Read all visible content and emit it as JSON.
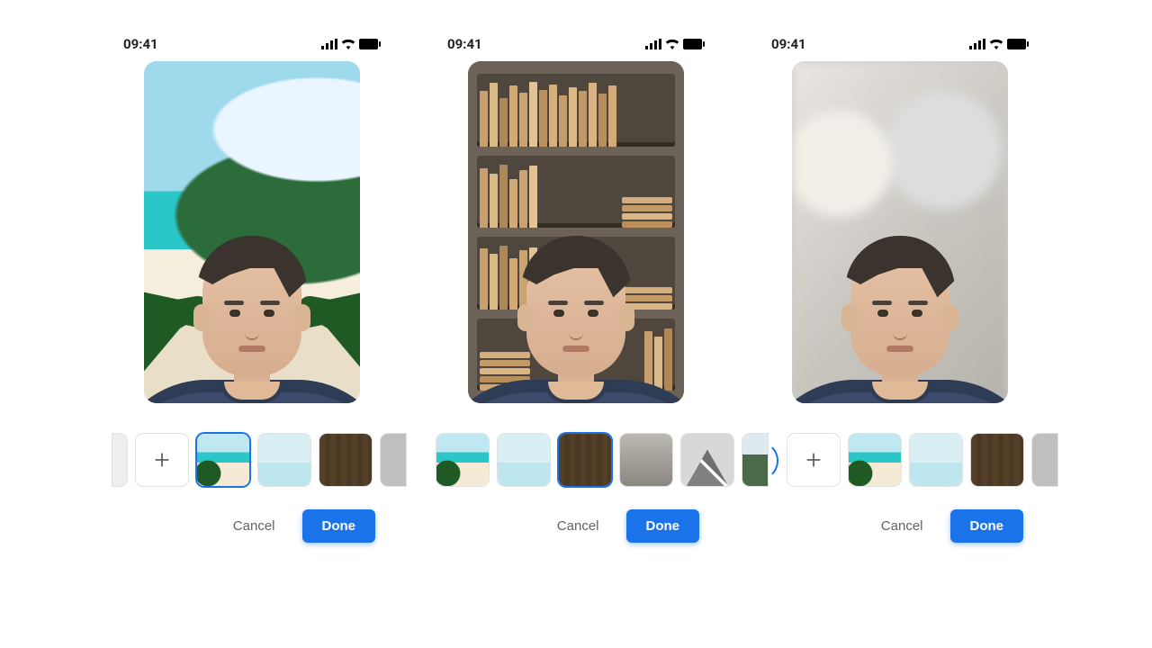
{
  "statusbar": {
    "time": "09:41"
  },
  "actions": {
    "cancel": "Cancel",
    "done": "Done"
  },
  "colors": {
    "accent": "#1a73e8"
  },
  "screens": [
    {
      "background": "beach",
      "thumbs": [
        {
          "kind": "partial-left"
        },
        {
          "kind": "add"
        },
        {
          "kind": "beach",
          "selected": true
        },
        {
          "kind": "beach2",
          "selected": false
        },
        {
          "kind": "books",
          "selected": false
        },
        {
          "kind": "partial-right",
          "style": "gray"
        }
      ]
    },
    {
      "background": "bookshelf",
      "thumbs": [
        {
          "kind": "beach",
          "selected": false
        },
        {
          "kind": "beach2",
          "selected": false
        },
        {
          "kind": "books",
          "selected": true
        },
        {
          "kind": "road",
          "selected": false
        },
        {
          "kind": "mount",
          "selected": false
        },
        {
          "kind": "partial-right",
          "style": "forest"
        }
      ]
    },
    {
      "background": "blur",
      "thumbs": [
        {
          "kind": "partial-arc"
        },
        {
          "kind": "add"
        },
        {
          "kind": "beach",
          "selected": false
        },
        {
          "kind": "beach2",
          "selected": false
        },
        {
          "kind": "books",
          "selected": false
        },
        {
          "kind": "partial-right",
          "style": "gray"
        }
      ]
    }
  ]
}
